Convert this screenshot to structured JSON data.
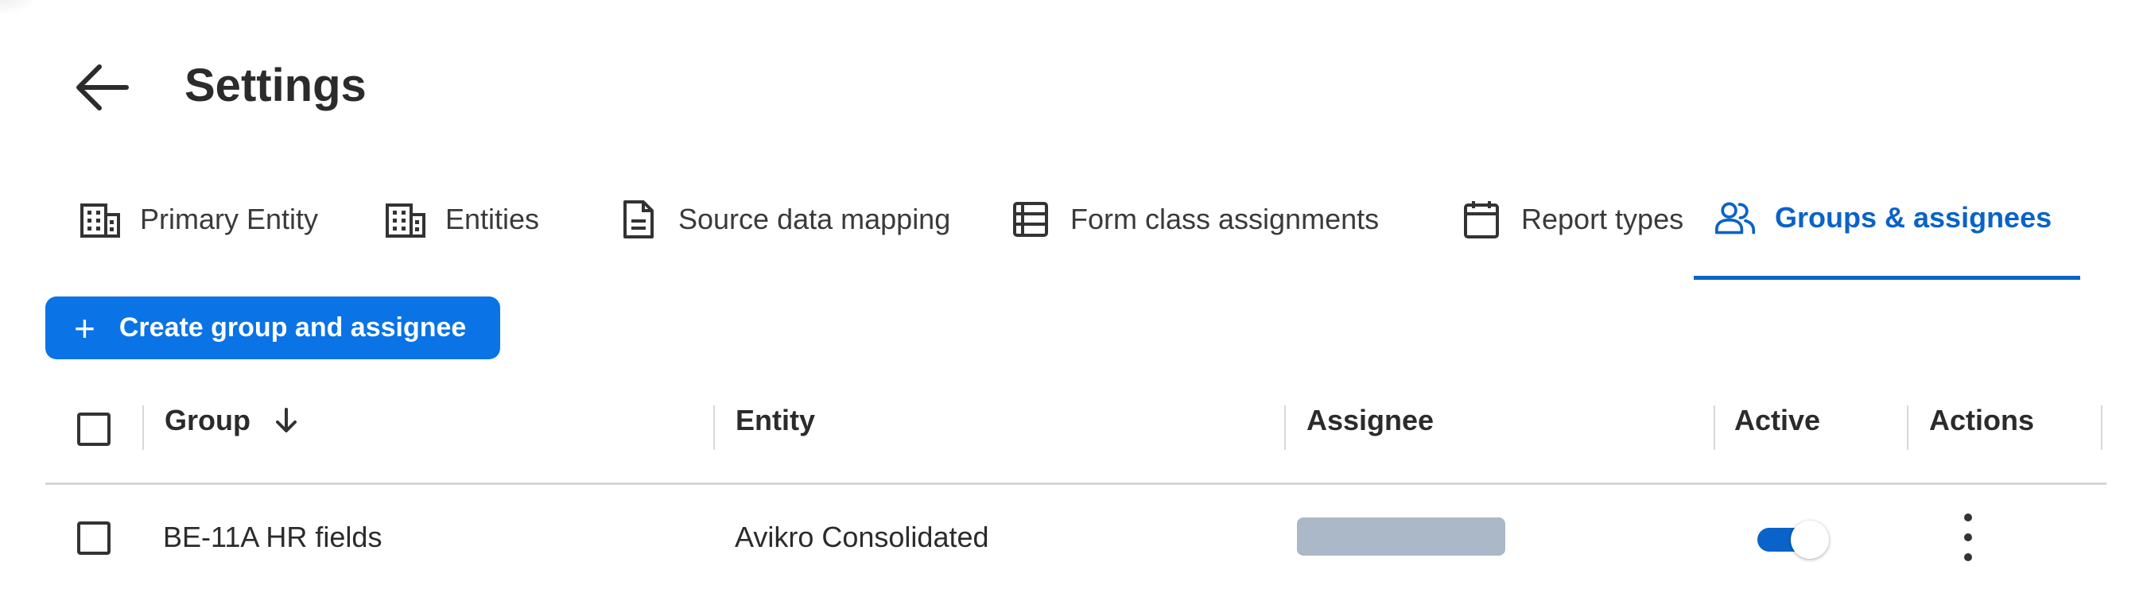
{
  "page": {
    "title": "Settings",
    "accent_color": "#0a63c8",
    "button_color": "#0a73e6"
  },
  "tabs": [
    {
      "label": "Primary Entity",
      "icon": "building-icon",
      "active": false
    },
    {
      "label": "Entities",
      "icon": "building-icon",
      "active": false
    },
    {
      "label": "Source data mapping",
      "icon": "document-icon",
      "active": false
    },
    {
      "label": "Form class assignments",
      "icon": "table-list-icon",
      "active": false
    },
    {
      "label": "Report types",
      "icon": "calendar-icon",
      "active": false
    },
    {
      "label": "Groups & assignees",
      "icon": "users-icon",
      "active": true
    }
  ],
  "toolbar": {
    "create_plus": "+",
    "create_label": "Create group and assignee"
  },
  "table": {
    "headers": {
      "group": "Group",
      "entity": "Entity",
      "assignee": "Assignee",
      "active": "Active",
      "actions": "Actions"
    },
    "sort": {
      "column": "group",
      "direction": "descending-arrow"
    },
    "rows": [
      {
        "group": "BE-11A HR fields",
        "entity": "Avikro Consolidated",
        "assignee": "",
        "active": true
      }
    ]
  }
}
